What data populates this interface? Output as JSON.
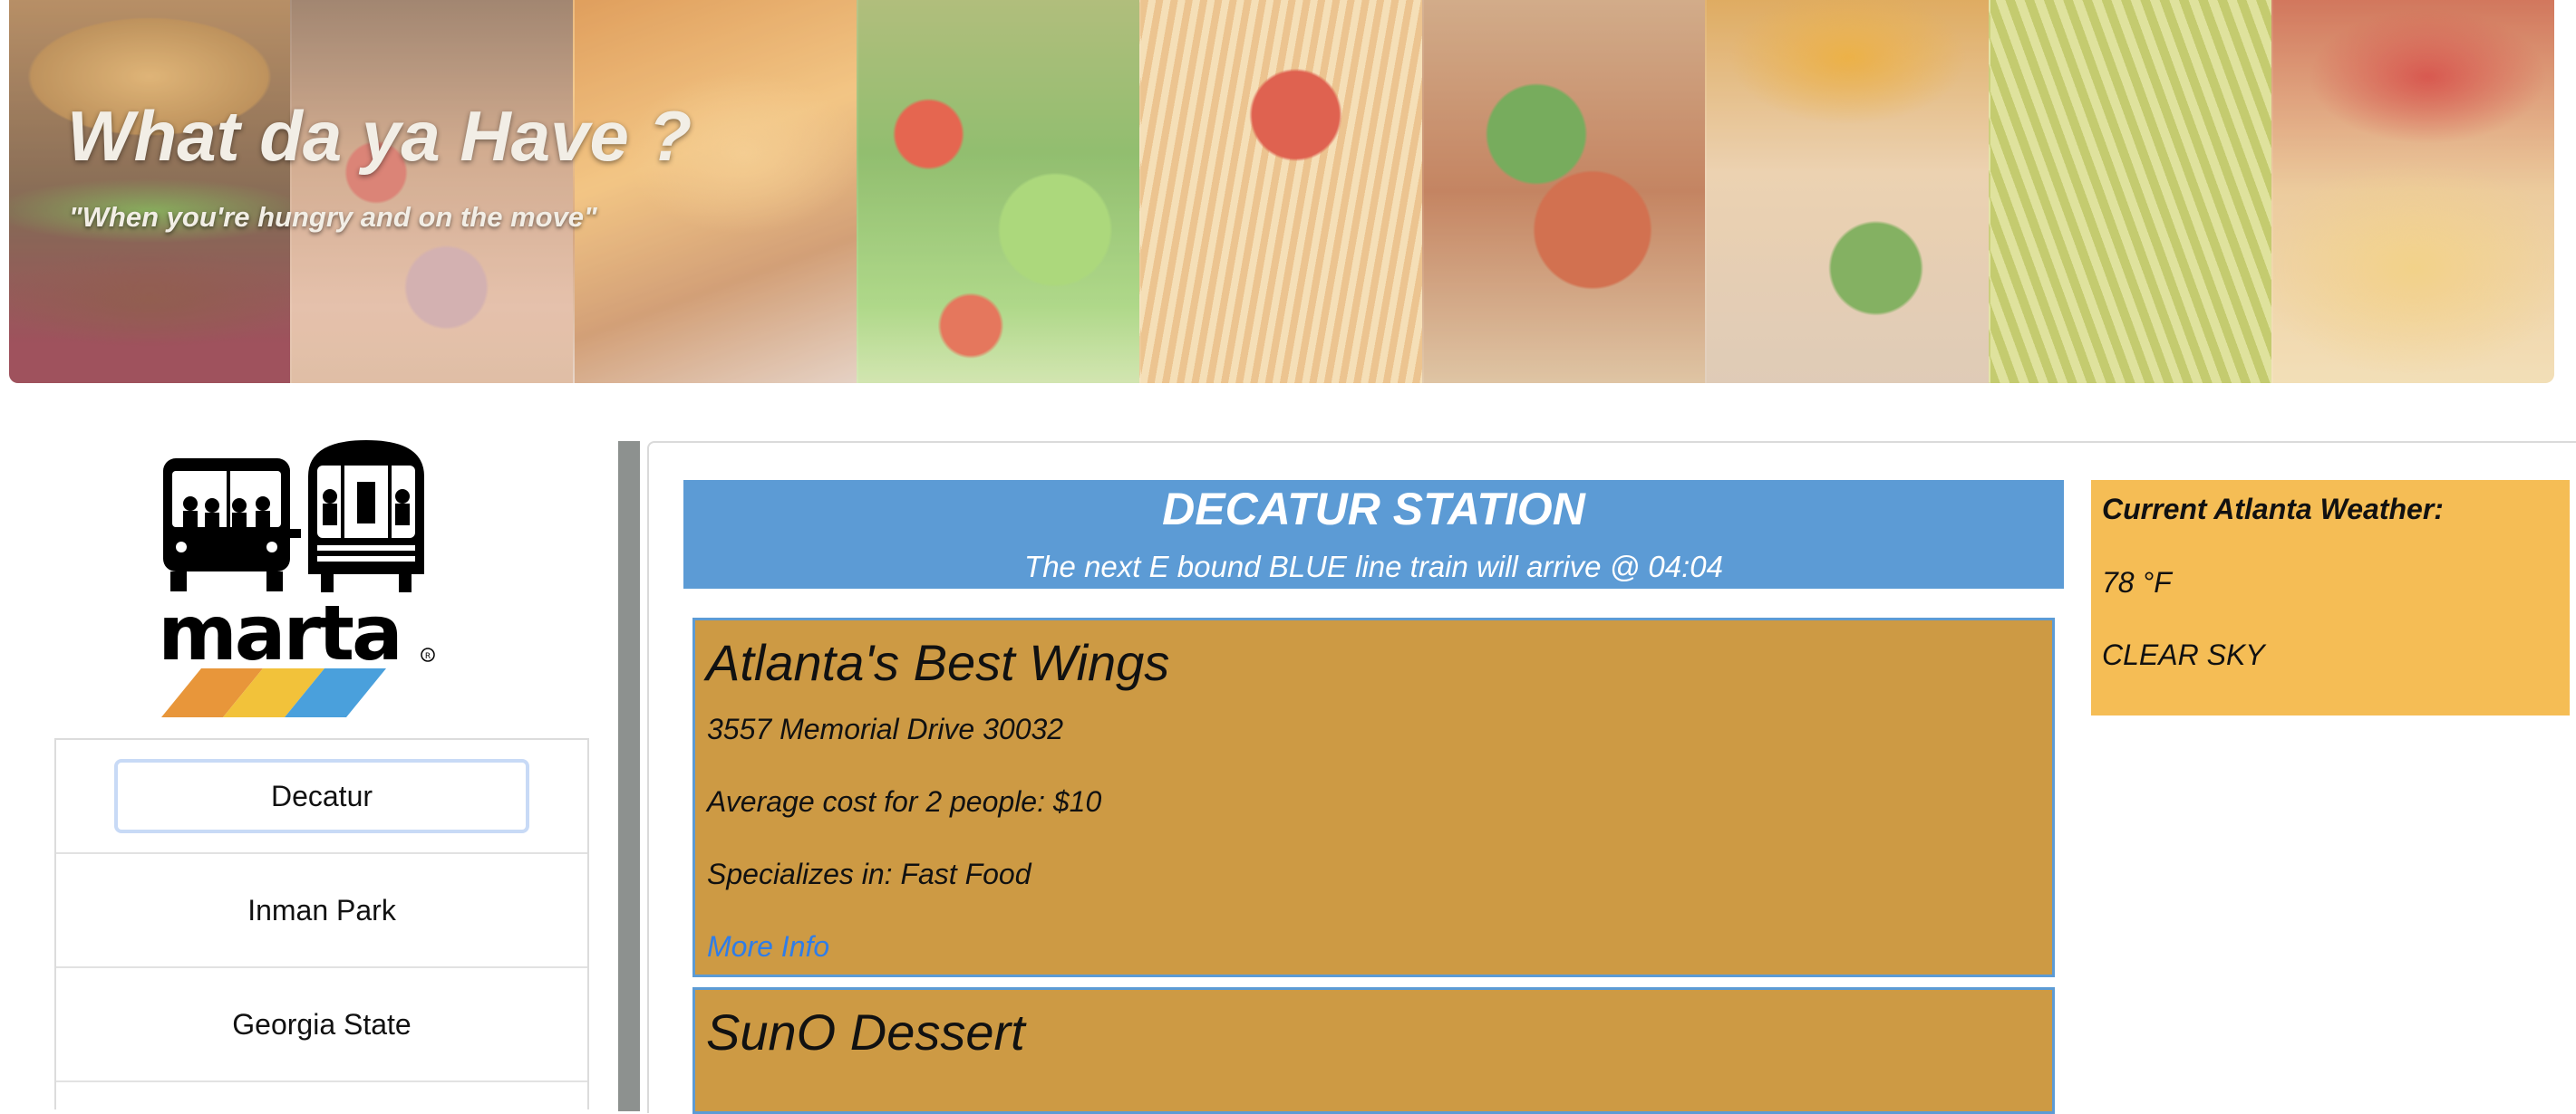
{
  "hero": {
    "title": "What da ya Have ?",
    "tagline": "\"When you're hungry and on the move\""
  },
  "logo": {
    "text": "marta",
    "stripe_colors": [
      "#e8963a",
      "#f2c23a",
      "#4aa0dc"
    ]
  },
  "stations": [
    {
      "label": "Decatur",
      "active": true
    },
    {
      "label": "Inman Park",
      "active": false
    },
    {
      "label": "Georgia State",
      "active": false
    }
  ],
  "station_header": {
    "name": "DECATUR STATION",
    "train_info": "The next E bound BLUE line train will arrive @ 04:04"
  },
  "restaurants": [
    {
      "name": "Atlanta's Best Wings",
      "address": "3557 Memorial Drive 30032",
      "cost": "Average cost for 2 people: $10",
      "specialty": "Specializes in: Fast Food",
      "link": "More Info"
    },
    {
      "name": "SunO Dessert"
    }
  ],
  "weather": {
    "heading": "Current Atlanta Weather:",
    "temperature": "78 °F",
    "condition": "CLEAR SKY"
  },
  "colors": {
    "header_blue": "#5c9bd5",
    "card_orange": "#cd9a44",
    "weather_yellow": "#f5bd55",
    "link_blue": "#2f7de8"
  }
}
